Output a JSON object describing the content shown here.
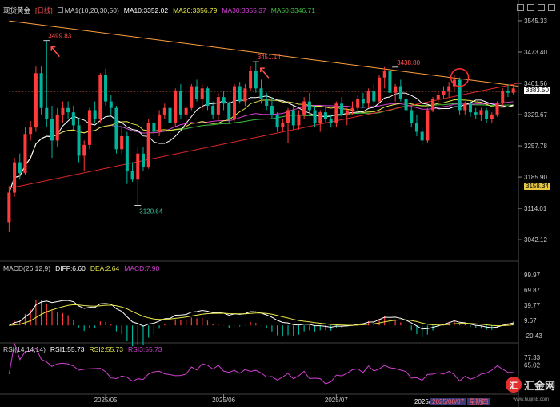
{
  "header": {
    "symbol": "现货黄金",
    "period": "[日线]",
    "ma1": "MA1(10,20,30,50)",
    "ma10": "MA10:3352.02",
    "ma20": "MA20:3356.79",
    "ma30": "MA30:3355.37",
    "ma50": "MA50:3346.71"
  },
  "macd_header": {
    "name": "MACD(26,12,9)",
    "diff": "DIFF:6.60",
    "dea": "DEA:2.64",
    "macd": "MACD:7.90"
  },
  "rsi_header": {
    "name": "RSI(14,14,14)",
    "rsi1": "RSI1:55.73",
    "rsi2": "RSI2:55.73",
    "rsi3": "RSI3:55.73"
  },
  "watermark": {
    "logo": "汇",
    "name": "汇金网",
    "url": "www.huijin8.com"
  },
  "crosshair_date": {
    "prefix": "2025/",
    "date": "2025/08/07",
    "weekday": "星期四"
  },
  "current_price": "3383.50",
  "hover_price": "3158.34",
  "colors": {
    "up": "#ff3b3b",
    "down": "#00b39a",
    "ma10": "#ffffff",
    "ma20": "#e8e84a",
    "ma30": "#d040d0",
    "ma50": "#40c040",
    "trend_upper": "#ffa040",
    "trend_lower": "#e02828",
    "annotation": "#ff5050"
  },
  "chart_data": {
    "type": "candlestick",
    "y_axis_ticks": [
      "3545.33",
      "3473.40",
      "3401.56",
      "3329.67",
      "3257.78",
      "3185.90",
      "3114.01",
      "3042.12"
    ],
    "ylim": [
      3000,
      3560
    ],
    "x_axis_ticks": [
      {
        "label": "2025/05",
        "index": 18
      },
      {
        "label": "2025/06",
        "index": 40
      },
      {
        "label": "2025/07",
        "index": 61
      }
    ],
    "price_annotations": [
      {
        "label": "3499.83",
        "index": 7,
        "value": 3499.83,
        "kind": "high"
      },
      {
        "label": "3451.14",
        "index": 46,
        "value": 3451.14,
        "kind": "high"
      },
      {
        "label": "3438.80",
        "index": 72,
        "value": 3438.8,
        "kind": "high"
      },
      {
        "label": "3120.64",
        "index": 24,
        "value": 3120.64,
        "kind": "low"
      }
    ],
    "candles": [
      [
        3082,
        3165,
        3060,
        3150
      ],
      [
        3150,
        3230,
        3140,
        3220
      ],
      [
        3220,
        3240,
        3180,
        3195
      ],
      [
        3195,
        3300,
        3190,
        3285
      ],
      [
        3285,
        3315,
        3270,
        3300
      ],
      [
        3300,
        3440,
        3290,
        3425
      ],
      [
        3425,
        3440,
        3330,
        3345
      ],
      [
        3345,
        3500,
        3300,
        3320
      ],
      [
        3320,
        3350,
        3230,
        3270
      ],
      [
        3270,
        3345,
        3255,
        3330
      ],
      [
        3330,
        3360,
        3310,
        3345
      ],
      [
        3345,
        3360,
        3320,
        3335
      ],
      [
        3335,
        3350,
        3295,
        3305
      ],
      [
        3305,
        3320,
        3220,
        3235
      ],
      [
        3235,
        3270,
        3200,
        3260
      ],
      [
        3260,
        3345,
        3250,
        3340
      ],
      [
        3340,
        3360,
        3310,
        3320
      ],
      [
        3320,
        3425,
        3310,
        3420
      ],
      [
        3420,
        3435,
        3350,
        3360
      ],
      [
        3360,
        3375,
        3330,
        3345
      ],
      [
        3345,
        3350,
        3240,
        3250
      ],
      [
        3250,
        3300,
        3240,
        3280
      ],
      [
        3280,
        3290,
        3170,
        3200
      ],
      [
        3200,
        3220,
        3175,
        3180
      ],
      [
        3180,
        3255,
        3120,
        3240
      ],
      [
        3240,
        3255,
        3200,
        3210
      ],
      [
        3210,
        3320,
        3205,
        3310
      ],
      [
        3310,
        3330,
        3280,
        3290
      ],
      [
        3290,
        3340,
        3280,
        3330
      ],
      [
        3330,
        3355,
        3320,
        3345
      ],
      [
        3345,
        3360,
        3300,
        3310
      ],
      [
        3310,
        3390,
        3300,
        3385
      ],
      [
        3385,
        3400,
        3320,
        3330
      ],
      [
        3330,
        3350,
        3300,
        3345
      ],
      [
        3345,
        3400,
        3340,
        3395
      ],
      [
        3395,
        3410,
        3360,
        3365
      ],
      [
        3365,
        3400,
        3340,
        3390
      ],
      [
        3390,
        3395,
        3340,
        3350
      ],
      [
        3350,
        3360,
        3320,
        3330
      ],
      [
        3330,
        3380,
        3315,
        3370
      ],
      [
        3370,
        3385,
        3340,
        3355
      ],
      [
        3355,
        3360,
        3310,
        3320
      ],
      [
        3320,
        3400,
        3315,
        3395
      ],
      [
        3395,
        3405,
        3355,
        3360
      ],
      [
        3360,
        3400,
        3350,
        3390
      ],
      [
        3390,
        3440,
        3385,
        3430
      ],
      [
        3430,
        3452,
        3380,
        3390
      ],
      [
        3390,
        3410,
        3355,
        3365
      ],
      [
        3365,
        3380,
        3340,
        3350
      ],
      [
        3350,
        3370,
        3320,
        3330
      ],
      [
        3330,
        3335,
        3290,
        3300
      ],
      [
        3300,
        3320,
        3290,
        3310
      ],
      [
        3310,
        3345,
        3265,
        3340
      ],
      [
        3340,
        3350,
        3295,
        3305
      ],
      [
        3305,
        3340,
        3295,
        3330
      ],
      [
        3330,
        3370,
        3320,
        3360
      ],
      [
        3360,
        3380,
        3330,
        3340
      ],
      [
        3340,
        3350,
        3300,
        3310
      ],
      [
        3310,
        3340,
        3290,
        3335
      ],
      [
        3335,
        3350,
        3310,
        3320
      ],
      [
        3320,
        3330,
        3300,
        3310
      ],
      [
        3310,
        3360,
        3300,
        3355
      ],
      [
        3355,
        3370,
        3325,
        3330
      ],
      [
        3330,
        3345,
        3305,
        3340
      ],
      [
        3340,
        3360,
        3330,
        3345
      ],
      [
        3345,
        3375,
        3330,
        3365
      ],
      [
        3365,
        3380,
        3345,
        3355
      ],
      [
        3355,
        3390,
        3345,
        3385
      ],
      [
        3385,
        3400,
        3350,
        3360
      ],
      [
        3360,
        3420,
        3355,
        3415
      ],
      [
        3415,
        3439,
        3390,
        3430
      ],
      [
        3430,
        3435,
        3370,
        3380
      ],
      [
        3380,
        3400,
        3360,
        3395
      ],
      [
        3395,
        3410,
        3360,
        3365
      ],
      [
        3365,
        3375,
        3330,
        3340
      ],
      [
        3340,
        3350,
        3300,
        3310
      ],
      [
        3310,
        3330,
        3280,
        3290
      ],
      [
        3290,
        3300,
        3260,
        3270
      ],
      [
        3270,
        3345,
        3265,
        3340
      ],
      [
        3340,
        3370,
        3335,
        3365
      ],
      [
        3365,
        3385,
        3355,
        3375
      ],
      [
        3375,
        3395,
        3365,
        3385
      ],
      [
        3385,
        3405,
        3370,
        3395
      ],
      [
        3395,
        3420,
        3385,
        3410
      ],
      [
        3410,
        3415,
        3330,
        3340
      ],
      [
        3340,
        3360,
        3330,
        3355
      ],
      [
        3355,
        3360,
        3325,
        3335
      ],
      [
        3335,
        3345,
        3320,
        3330
      ],
      [
        3330,
        3345,
        3315,
        3340
      ],
      [
        3340,
        3345,
        3310,
        3320
      ],
      [
        3320,
        3335,
        3310,
        3330
      ],
      [
        3330,
        3360,
        3325,
        3355
      ],
      [
        3355,
        3390,
        3350,
        3385
      ],
      [
        3385,
        3400,
        3370,
        3380
      ],
      [
        3380,
        3395,
        3375,
        3390
      ]
    ],
    "trendlines": [
      {
        "name": "upper",
        "from": [
          0,
          3545
        ],
        "to": [
          95,
          3395
        ]
      },
      {
        "name": "lower",
        "from": [
          0,
          3160
        ],
        "to": [
          95,
          3402
        ]
      },
      {
        "name": "horizontal",
        "from": [
          0,
          3383.5
        ],
        "to": [
          95,
          3383.5
        ]
      }
    ],
    "macd_axis_ticks": [
      "99.97",
      "69.87",
      "39.77",
      "9.67",
      "-20.43"
    ],
    "macd_ylim": [
      -25,
      105
    ],
    "rsi_axis_ticks": [
      "77.33",
      "65.02"
    ],
    "rsi_ylim": [
      20,
      85
    ]
  }
}
